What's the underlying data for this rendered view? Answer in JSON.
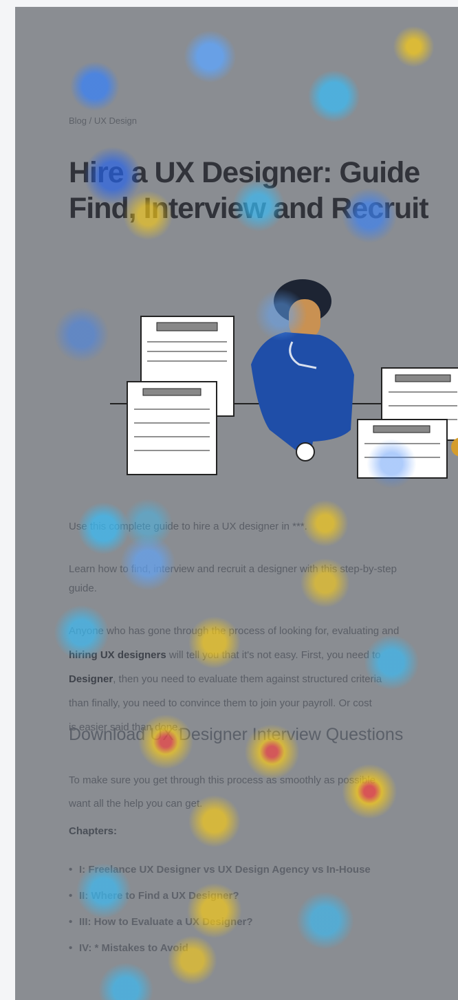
{
  "breadcrumb": "Blog / UX Design",
  "title_line1": "Hire a UX Designer: Guide",
  "title_line2": "Find, Interview and Recruit",
  "intro_line": "Use this complete guide to hire a UX designer in ***.",
  "learn_line1": "Learn how to find, interview and recruit a designer with this step-by-step",
  "learn_line2": "guide.",
  "para": {
    "part1": "Anyone who has gone through the process of looking for, evaluating and",
    "bold1": "hiring UX designers",
    "part2": " will tell you that it's not easy. First, you need to",
    "bold2": "Designer",
    "part3": ", then you need to evaluate them against structured criteria",
    "part4": "than finally, you need to convince them to join your payroll. Or cost",
    "part5": "is easier said than done."
  },
  "section_heading": "Download UX Designer Interview Questions",
  "process_line1": "To make sure you get through this process as smoothly as possible",
  "process_line2": "want all the help you can get.",
  "chapters_label": "Chapters:",
  "chapters": [
    "I: Freelance UX Designer vs UX Design Agency vs In-House",
    "II: Where to Find a UX Designer?",
    "III: How to Evaluate a UX Designer?",
    "IV: * Mistakes to Avoid"
  ],
  "colors": {
    "background": "#f4f5f7",
    "overlay_gray": "#8a8d92",
    "heat_low": "#3b82f6",
    "heat_mid": "#facc15",
    "heat_high": "#ef4444"
  }
}
